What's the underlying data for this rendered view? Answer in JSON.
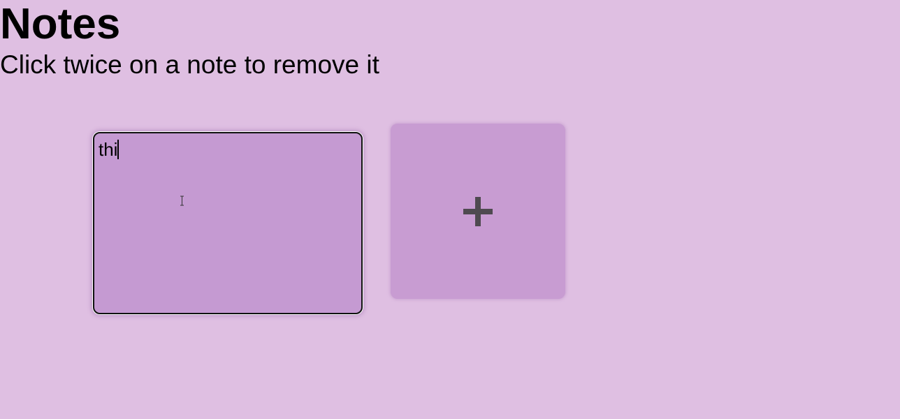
{
  "header": {
    "title": "Notes",
    "subtitle": "Click twice on a note to remove it"
  },
  "notes": [
    {
      "text": "thi"
    }
  ],
  "add_button": {
    "icon": "plus-icon"
  },
  "colors": {
    "background": "#dfbfe2",
    "note": "#c59ad2",
    "add_button": "#c89cd2",
    "plus": "#4f4a50"
  }
}
